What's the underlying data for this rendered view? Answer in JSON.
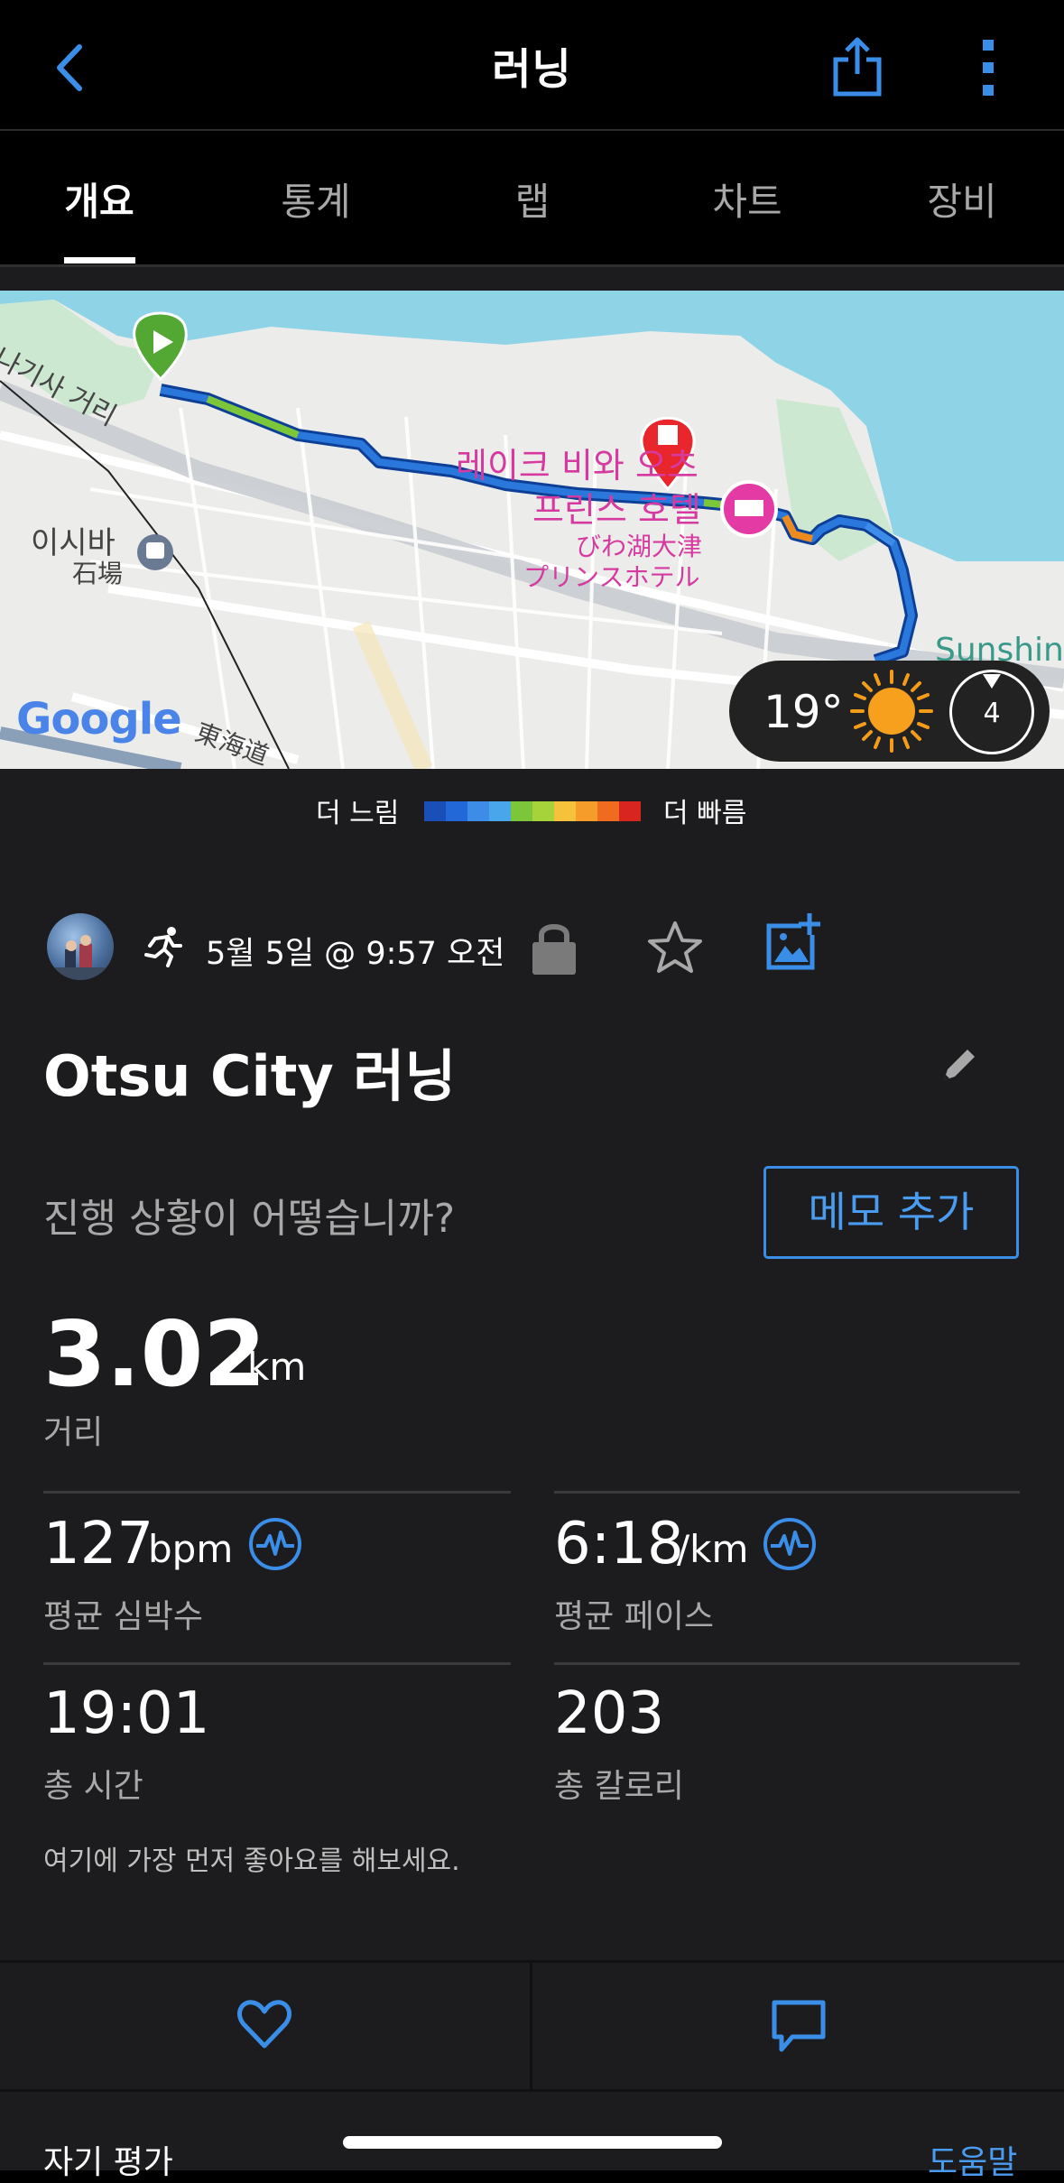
{
  "header": {
    "title": "러닝",
    "back_icon": "chevron-left-icon",
    "share_icon": "share-icon",
    "more_icon": "more-vertical-icon"
  },
  "tabs": [
    {
      "label": "개요",
      "active": true
    },
    {
      "label": "통계",
      "active": false
    },
    {
      "label": "랩",
      "active": false
    },
    {
      "label": "차트",
      "active": false
    },
    {
      "label": "장비",
      "active": false
    }
  ],
  "map": {
    "labels": {
      "street": "나기사 거리",
      "station_ko": "이시바",
      "station_ja": "石場",
      "hotel_ko_1": "레이크 비와 오츠",
      "hotel_ko_2": "프린스 호텔",
      "hotel_ja_1": "びわ湖大津",
      "hotel_ja_2": "プリンスホテル",
      "road": "東海道",
      "sunshine": "Sunshin",
      "google": "Google"
    },
    "weather": {
      "temperature": "19°",
      "wind": "4",
      "condition_icon": "sun-icon"
    }
  },
  "pace_legend": {
    "slow_label": "더 느림",
    "fast_label": "더 빠름",
    "colors": [
      "#1b4fb8",
      "#2268d8",
      "#3c8ce8",
      "#4aa6ea",
      "#7cc63a",
      "#a6d23a",
      "#f6c23b",
      "#f59c2a",
      "#ee6b1f",
      "#d9251f"
    ]
  },
  "activity": {
    "date": "5월 5일 @ 9:57 오전",
    "name": "Otsu City 러닝",
    "prompt": "진행 상황이 어떻습니까?",
    "memo_button": "메모 추가"
  },
  "stats": {
    "distance": {
      "value": "3.02",
      "unit": "km",
      "label": "거리"
    },
    "avg_hr": {
      "value": "127",
      "unit": "bpm",
      "label": "평균 심박수"
    },
    "avg_pace": {
      "value": "6:18",
      "unit": "/km",
      "label": "평균 페이스"
    },
    "total_time": {
      "value": "19:01",
      "label": "총 시간"
    },
    "calories": {
      "value": "203",
      "label": "총 칼로리"
    }
  },
  "social": {
    "like_prompt": "여기에 가장 먼저 좋아요를 해보세요.",
    "like_icon": "heart-icon",
    "comment_icon": "comment-icon"
  },
  "footer": {
    "self_eval": "자기 평가",
    "help": "도움말"
  },
  "colors": {
    "accent": "#3a8ee8",
    "background": "#1c1c1e",
    "header": "#000000"
  }
}
